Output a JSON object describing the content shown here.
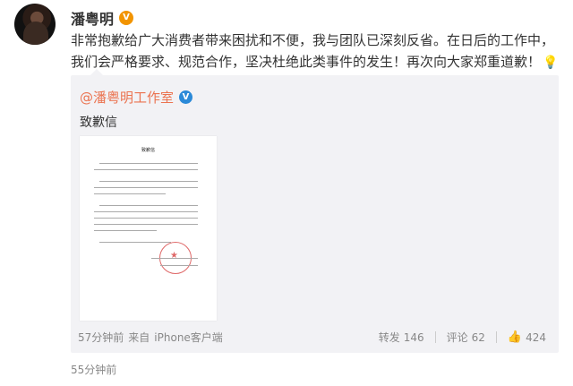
{
  "post": {
    "author": "潘粤明",
    "author_badge": "V",
    "text": "非常抱歉给广大消费者带来困扰和不便，我与团队已深刻反省。在日后的工作中，我们会严格要求、规范合作，坚决杜绝此类事件的发生！再次向大家郑重道歉！",
    "emoji": [
      "💡",
      "💡",
      "💡"
    ],
    "time": "55分钟前"
  },
  "repost": {
    "author": "@潘粤明工作室",
    "author_badge": "V",
    "text": "致歉信",
    "letter_title": "致歉信",
    "time": "57分钟前",
    "source_prefix": "来自",
    "source": "iPhone客户端",
    "share_label": "转发",
    "share_count": "146",
    "comment_label": "评论",
    "comment_count": "62",
    "like_count": "424"
  },
  "colors": {
    "accent": "#eb7350",
    "repost_bg": "#f2f2f5",
    "orange_badge": "#f29400",
    "blue_badge": "#2b8ad8"
  }
}
